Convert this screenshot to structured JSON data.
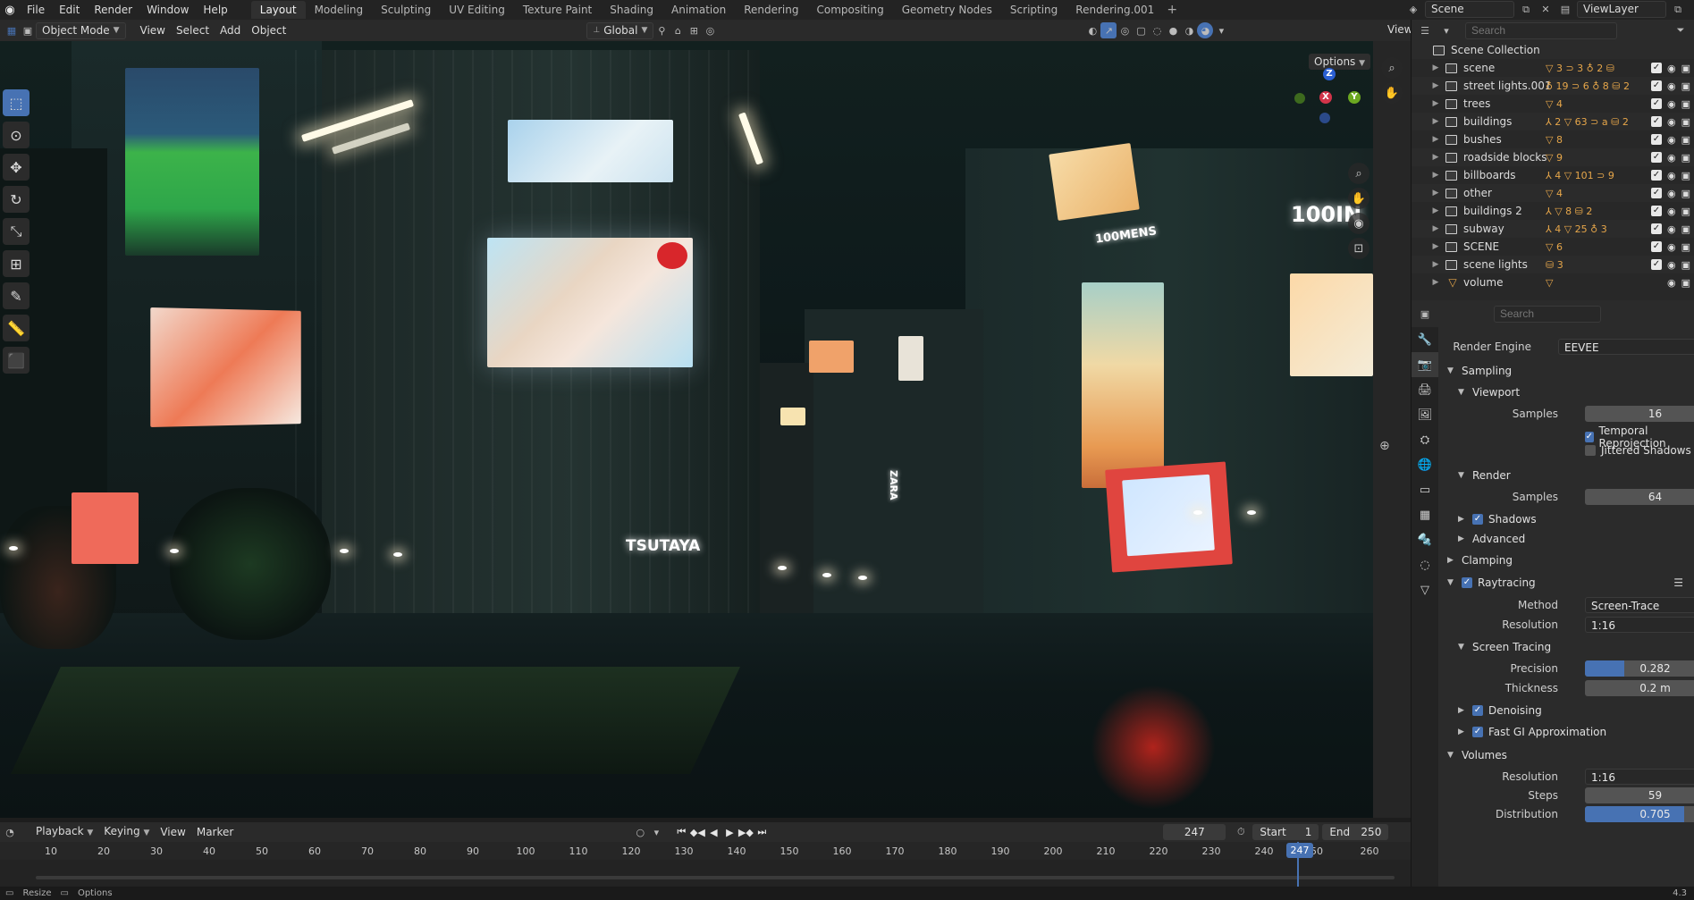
{
  "menu": {
    "items": [
      "File",
      "Edit",
      "Render",
      "Window",
      "Help"
    ]
  },
  "workspaces": [
    "Layout",
    "Modeling",
    "Sculpting",
    "UV Editing",
    "Texture Paint",
    "Shading",
    "Animation",
    "Rendering",
    "Compositing",
    "Geometry Nodes",
    "Scripting",
    "Rendering.001"
  ],
  "active_workspace": "Layout",
  "scene": {
    "name": "Scene",
    "view_layer": "ViewLayer"
  },
  "viewport": {
    "mode": "Object Mode",
    "menus": [
      "View",
      "Select",
      "Add",
      "Object"
    ],
    "transform": "Global",
    "options_label": "Options",
    "view_label": "View",
    "signs": {
      "tsutaya": "TSUTAYA",
      "mens": "100MENS",
      "zara": "ZARA",
      "right_top": "100IN"
    }
  },
  "outliner": {
    "search_placeholder": "Search",
    "root": "Scene Collection",
    "items": [
      {
        "label": "scene",
        "badges": "▽ 3  ⊃ 3  ♁ 2  ⛁"
      },
      {
        "label": "street lights.001",
        "badges": "♁ 19  ⊃ 6  ♁ 8  ⛁ 2"
      },
      {
        "label": "trees",
        "badges": "▽ 4"
      },
      {
        "label": "buildings",
        "badges": "⅄ 2  ▽ 63  ⊃  a  ⛁ 2"
      },
      {
        "label": "bushes",
        "badges": "▽ 8"
      },
      {
        "label": "roadside blocks",
        "badges": "▽ 9"
      },
      {
        "label": "billboards",
        "badges": "⅄ 4  ▽ 101  ⊃ 9"
      },
      {
        "label": "other",
        "badges": "▽ 4"
      },
      {
        "label": "buildings 2",
        "badges": "⅄  ▽ 8  ⛁ 2"
      },
      {
        "label": "subway",
        "badges": "⅄ 4  ▽ 25  ♁ 3"
      },
      {
        "label": "SCENE",
        "badges": "▽ 6"
      },
      {
        "label": "scene lights",
        "badges": "⛁ 3"
      },
      {
        "label": "volume",
        "badges": "▽"
      }
    ]
  },
  "properties": {
    "search_placeholder": "Search",
    "render_engine_label": "Render Engine",
    "render_engine": "EEVEE",
    "sampling": "Sampling",
    "viewport": "Viewport",
    "viewport_samples_label": "Samples",
    "viewport_samples": "16",
    "temporal_reprojection": "Temporal Reprojection",
    "jittered_shadows": "Jittered Shadows",
    "render": "Render",
    "render_samples_label": "Samples",
    "render_samples": "64",
    "shadows": "Shadows",
    "advanced": "Advanced",
    "clamping": "Clamping",
    "raytracing": "Raytracing",
    "method_label": "Method",
    "method": "Screen-Trace",
    "resolution_label": "Resolution",
    "resolution": "1:16",
    "screen_tracing": "Screen Tracing",
    "precision_label": "Precision",
    "precision": "0.282",
    "precision_fill": 0.282,
    "thickness_label": "Thickness",
    "thickness": "0.2 m",
    "denoising": "Denoising",
    "fast_gi": "Fast GI Approximation",
    "volumes": "Volumes",
    "vol_resolution_label": "Resolution",
    "vol_resolution": "1:16",
    "steps_label": "Steps",
    "steps": "59",
    "distribution_label": "Distribution",
    "distribution": "0.705",
    "distribution_fill": 0.705
  },
  "timeline": {
    "menus": [
      "Playback",
      "Keying",
      "View",
      "Marker"
    ],
    "current_frame": "247",
    "start_label": "Start",
    "start": "1",
    "end_label": "End",
    "end": "250",
    "ticks": [
      "10",
      "20",
      "30",
      "40",
      "50",
      "60",
      "70",
      "80",
      "90",
      "100",
      "110",
      "120",
      "130",
      "140",
      "150",
      "160",
      "170",
      "180",
      "190",
      "200",
      "210",
      "220",
      "230",
      "240",
      "50",
      "260"
    ],
    "playhead": "247"
  },
  "status": {
    "left": "Resize",
    "options": "Options",
    "version": "4.3"
  },
  "colors": {
    "accent": "#4772b3",
    "active_tab": "#303030",
    "orange": "#e6a64a"
  }
}
